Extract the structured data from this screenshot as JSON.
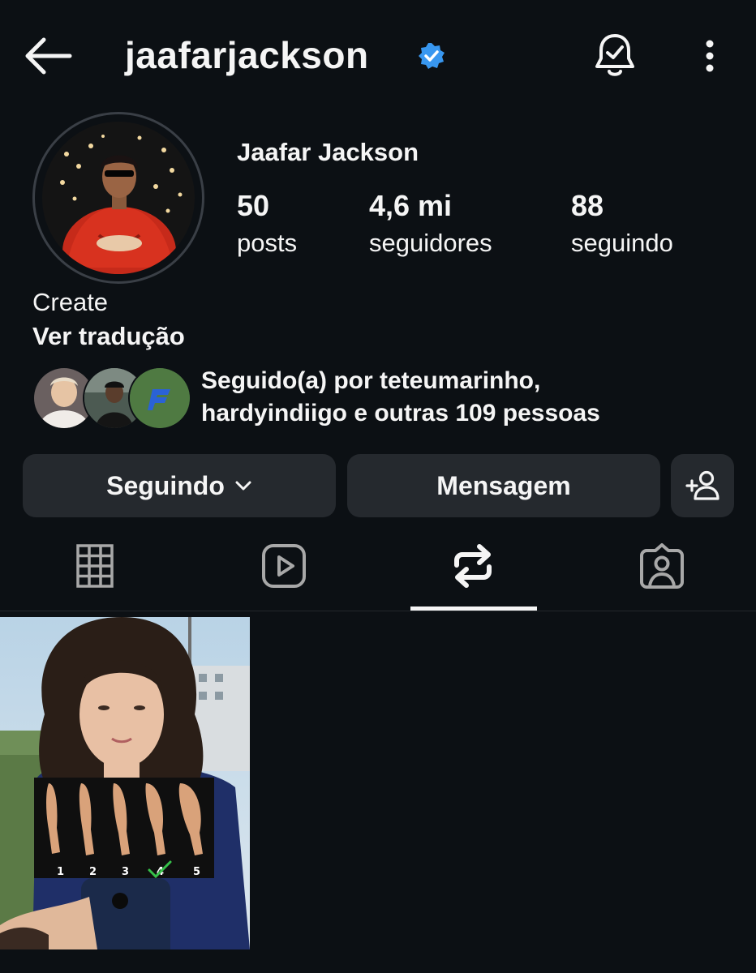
{
  "header": {
    "username": "jaafarjackson",
    "verified": true,
    "icons": {
      "back": "arrow-left-icon",
      "notifications": "bell-check-icon",
      "more": "more-vertical-icon"
    }
  },
  "profile": {
    "full_name": "Jaafar Jackson",
    "stats": [
      {
        "value": "50",
        "label": "posts"
      },
      {
        "value": "4,6 mi",
        "label": "seguidores"
      },
      {
        "value": "88",
        "label": "seguindo"
      }
    ],
    "bio": "Create",
    "translate_label": "Ver tradução",
    "followed_by_line1": "Seguido(a) por teteumarinho,",
    "followed_by_line2": "hardyindiigo e outras 109 pessoas"
  },
  "actions": {
    "following_label": "Seguindo",
    "message_label": "Mensagem",
    "add_user_icon": "person-add-icon"
  },
  "tabs": [
    {
      "icon": "grid-icon",
      "selected": false
    },
    {
      "icon": "reels-icon",
      "selected": false
    },
    {
      "icon": "reposts-icon",
      "selected": true
    },
    {
      "icon": "tagged-icon",
      "selected": false
    }
  ],
  "posts": [
    {
      "type": "image",
      "overlay_numbers": [
        "1",
        "2",
        "3",
        "4",
        "5"
      ]
    }
  ],
  "colors": {
    "background": "#0c1014",
    "button": "#25292e",
    "verified": "#3897f0",
    "text": "#f5f5f5"
  }
}
